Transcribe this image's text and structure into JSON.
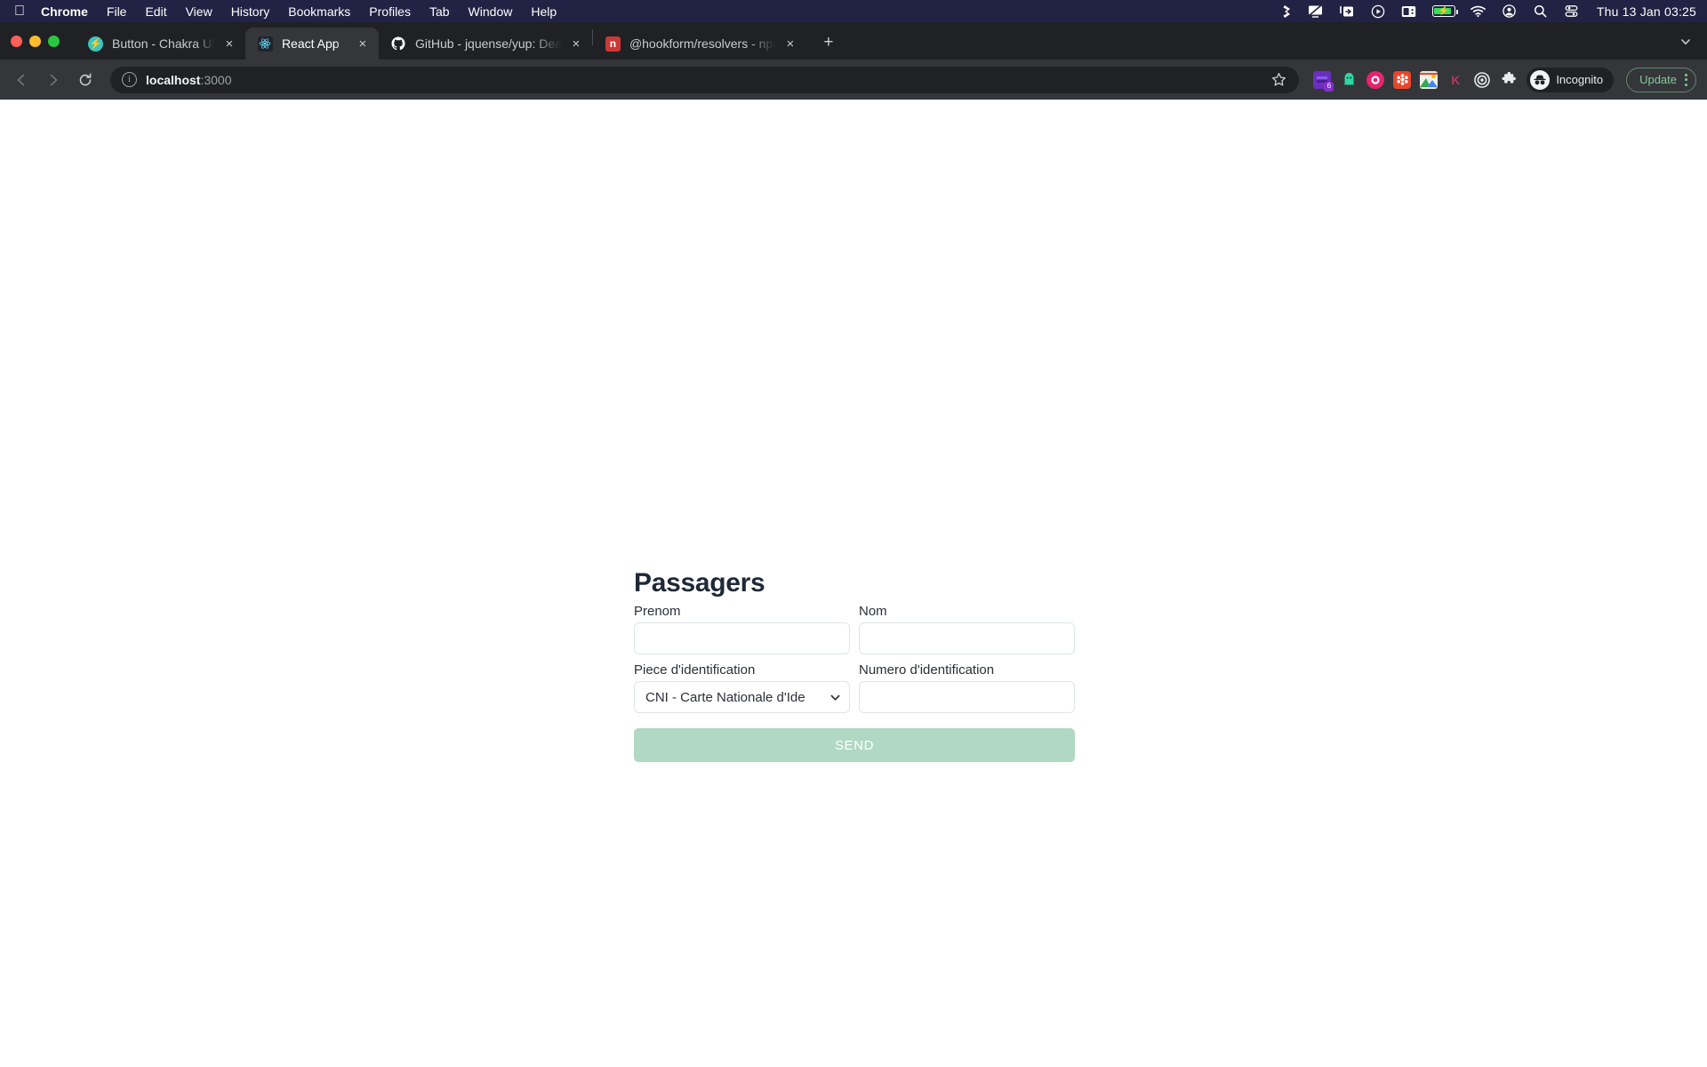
{
  "menubar": {
    "apple_icon": "apple-logo",
    "items": [
      {
        "label": "Chrome",
        "bold": true
      },
      {
        "label": "File",
        "bold": false
      },
      {
        "label": "Edit",
        "bold": false
      },
      {
        "label": "View",
        "bold": false
      },
      {
        "label": "History",
        "bold": false
      },
      {
        "label": "Bookmarks",
        "bold": false
      },
      {
        "label": "Profiles",
        "bold": false
      },
      {
        "label": "Tab",
        "bold": false
      },
      {
        "label": "Window",
        "bold": false
      },
      {
        "label": "Help",
        "bold": false
      }
    ],
    "status_icons": [
      "dropbox-icon",
      "display-icon",
      "screen-share-icon",
      "play-circle-icon",
      "calendar-icon",
      "battery-icon",
      "wifi-icon",
      "user-account-icon",
      "search-icon",
      "control-center-icon"
    ],
    "battery_charging": true,
    "clock": "Thu 13 Jan  03:25"
  },
  "window": {
    "traffic_lights": [
      "close-button",
      "minimize-button",
      "maximize-button"
    ]
  },
  "tabs": [
    {
      "title": "Button - Chakra UI",
      "favicon": "chakra-ui-icon",
      "active": false
    },
    {
      "title": "React App",
      "favicon": "react-icon",
      "active": true
    },
    {
      "title": "GitHub - jquense/yup: Dead si",
      "favicon": "github-icon",
      "active": false
    },
    {
      "title": "@hookform/resolvers - npm",
      "favicon": "npm-icon",
      "active": false
    }
  ],
  "tabstrip": {
    "new_tab_label": "+",
    "close_label": "×",
    "collapse_icon": "chevron-down-icon"
  },
  "toolbar": {
    "back_icon": "back-arrow-icon",
    "forward_icon": "forward-arrow-icon",
    "reload_icon": "reload-icon",
    "site_info_icon": "info-circle-icon",
    "url_host": "localhost",
    "url_port": ":3000",
    "url_full": "localhost:3000",
    "bookmark_icon": "star-icon",
    "extensions": [
      {
        "name": "books-extension-icon",
        "glyph": "▮",
        "color": "#6b2fc0",
        "badge": "6"
      },
      {
        "name": "ghostery-extension-icon",
        "glyph": "▲",
        "color": "#2fd6a8",
        "badge": ""
      },
      {
        "name": "adblock-extension-icon",
        "glyph": "●",
        "color": "#e8236f",
        "badge": ""
      },
      {
        "name": "honey-extension-icon",
        "glyph": "✱",
        "color": "#e8472b",
        "badge": ""
      },
      {
        "name": "screenshot-extension-icon",
        "glyph": "▣",
        "color": "#4a90d9",
        "badge": ""
      },
      {
        "name": "kami-extension-icon",
        "glyph": "K",
        "color": "#b03a5b",
        "badge": ""
      },
      {
        "name": "target-extension-icon",
        "glyph": "◎",
        "color": "#d6d8da",
        "badge": ""
      }
    ],
    "puzzle_icon": "extensions-puzzle-icon",
    "profile_label": "Incognito",
    "profile_icon": "incognito-icon",
    "update_label": "Update",
    "menu_icon": "kebab-menu-icon"
  },
  "page": {
    "title": "Passagers",
    "fields": {
      "prenom": {
        "label": "Prenom",
        "value": "",
        "placeholder": ""
      },
      "nom": {
        "label": "Nom",
        "value": "",
        "placeholder": ""
      },
      "piece": {
        "label": "Piece d'identification",
        "selected": "CNI - Carte Nationale d'Ide",
        "chevron_icon": "chevron-down-icon"
      },
      "numero": {
        "label": "Numero d'identification",
        "value": "",
        "placeholder": ""
      }
    },
    "submit_label": "SEND",
    "submit_color": "#b0d8c3"
  }
}
